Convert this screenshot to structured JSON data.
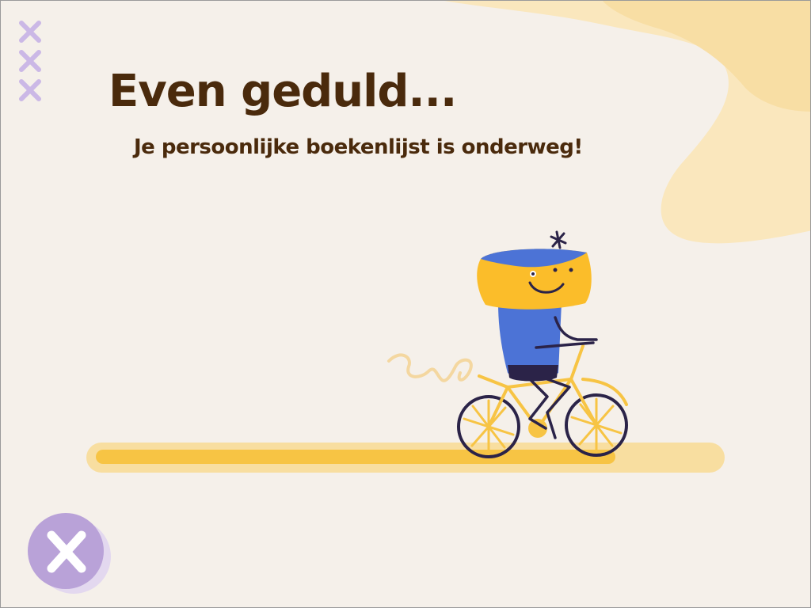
{
  "loading": {
    "title": "Even geduld...",
    "subtitle": "Je persoonlijke boekenlijst is onderweg!",
    "progress": 0.83
  },
  "icons": {
    "decoration": "x-marks-icon",
    "character": "cyclist-mascot-icon",
    "close": "close-icon"
  },
  "colors": {
    "background": "#f5f0ea",
    "blob": "#f9e3a8",
    "text": "#4a2a0c",
    "accent_purple": "#b9a2d8",
    "progress_track": "#f8dea0",
    "progress_fill": "#f7c444",
    "mascot_yellow": "#fbbd2a",
    "mascot_blue": "#4c73d6",
    "outline": "#2b2348"
  }
}
